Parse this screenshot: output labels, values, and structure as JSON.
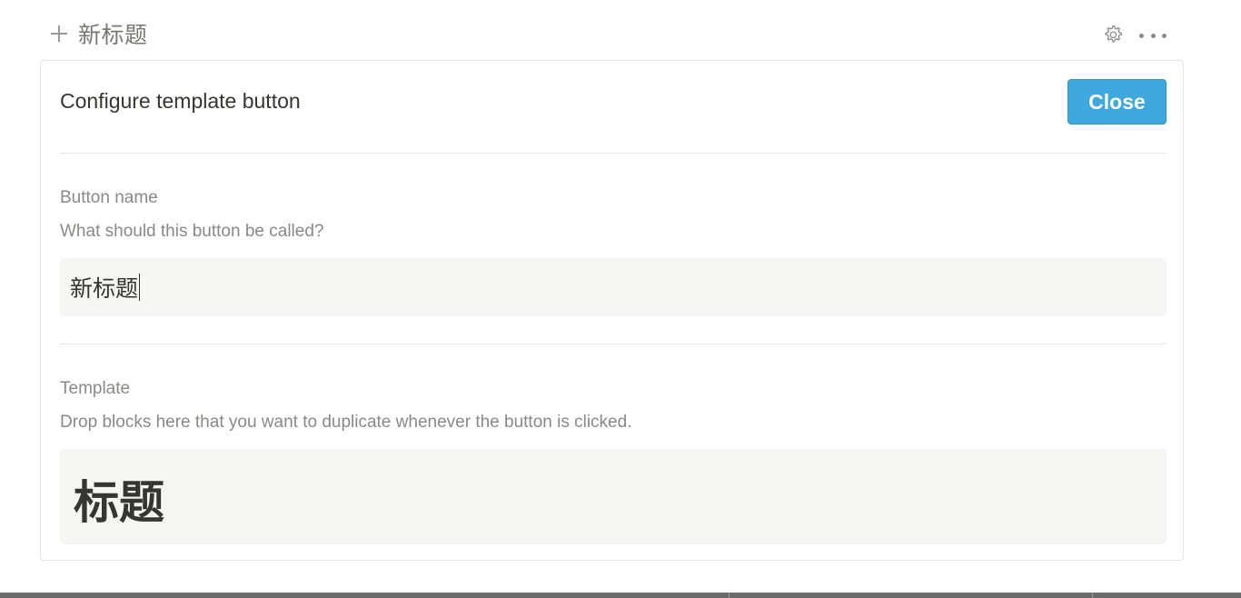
{
  "toolbar": {
    "add_button_label": "新标题",
    "icons": {
      "add": "plus-icon",
      "settings": "gear-icon",
      "more": "more-horizontal-icon"
    }
  },
  "config_panel": {
    "title": "Configure template button",
    "close_label": "Close",
    "button_name": {
      "label": "Button name",
      "help": "What should this button be called?",
      "value": "新标题"
    },
    "template": {
      "label": "Template",
      "help": "Drop blocks here that you want to duplicate whenever the button is clicked.",
      "heading": "标题"
    }
  },
  "colors": {
    "accent": "#3ea8dd",
    "text": "#37352f",
    "muted_text": "#8a8985",
    "input_background": "#f6f5f2",
    "border": "#e5e4e1"
  }
}
